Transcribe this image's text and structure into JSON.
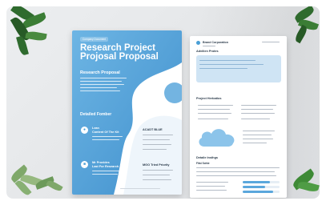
{
  "left_page": {
    "tag": "Company Document",
    "title_line1": "Research Project",
    "title_line2": "Projosal Proposal",
    "section1": "Research Proposal",
    "section2": "Detailed Fomber",
    "item1_line1": "Lean",
    "item1_line2": "Content Of The Kit",
    "item2_line1": "Mr Provides",
    "item2_line2": "Last For Research",
    "item3": "ACADT BLUE",
    "item4": "MGO Tried Priority"
  },
  "right_page": {
    "header": "Brand Corporation",
    "section1": "Advilien Protes",
    "section2": "Project Herbatios",
    "section3": "Detaile Insthgs",
    "subsection": "Fitst Sohte"
  },
  "colors": {
    "primary_blue": "#4a9fd6",
    "light_blue": "#cfe4f4",
    "background": "#e6e8ea",
    "leaf_green": "#2f6b2e"
  }
}
